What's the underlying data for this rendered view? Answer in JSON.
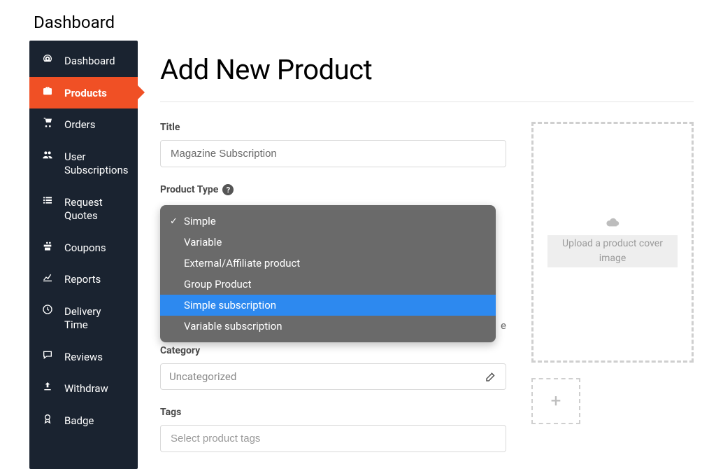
{
  "page_title": "Dashboard",
  "sidebar": {
    "items": [
      {
        "label": "Dashboard",
        "icon": "dashboard"
      },
      {
        "label": "Products",
        "icon": "briefcase",
        "active": true
      },
      {
        "label": "Orders",
        "icon": "cart"
      },
      {
        "label": "User Subscriptions",
        "icon": "users"
      },
      {
        "label": "Request Quotes",
        "icon": "list"
      },
      {
        "label": "Coupons",
        "icon": "gift"
      },
      {
        "label": "Reports",
        "icon": "chart"
      },
      {
        "label": "Delivery Time",
        "icon": "clock"
      },
      {
        "label": "Reviews",
        "icon": "comment"
      },
      {
        "label": "Withdraw",
        "icon": "upload"
      },
      {
        "label": "Badge",
        "icon": "award"
      }
    ]
  },
  "content": {
    "heading": "Add New Product",
    "title_label": "Title",
    "title_value": "Magazine Subscription",
    "product_type_label": "Product Type",
    "product_type_options": [
      {
        "label": "Simple",
        "checked": true
      },
      {
        "label": "Variable"
      },
      {
        "label": "External/Affiliate product"
      },
      {
        "label": "Group Product"
      },
      {
        "label": "Simple subscription",
        "highlighted": true
      },
      {
        "label": "Variable subscription"
      }
    ],
    "behind_trailing_char": "e",
    "category_label": "Category",
    "category_value": "Uncategorized",
    "tags_label": "Tags",
    "tags_placeholder": "Select product tags",
    "upload_text": "Upload a product cover image",
    "add_button_label": "+"
  }
}
